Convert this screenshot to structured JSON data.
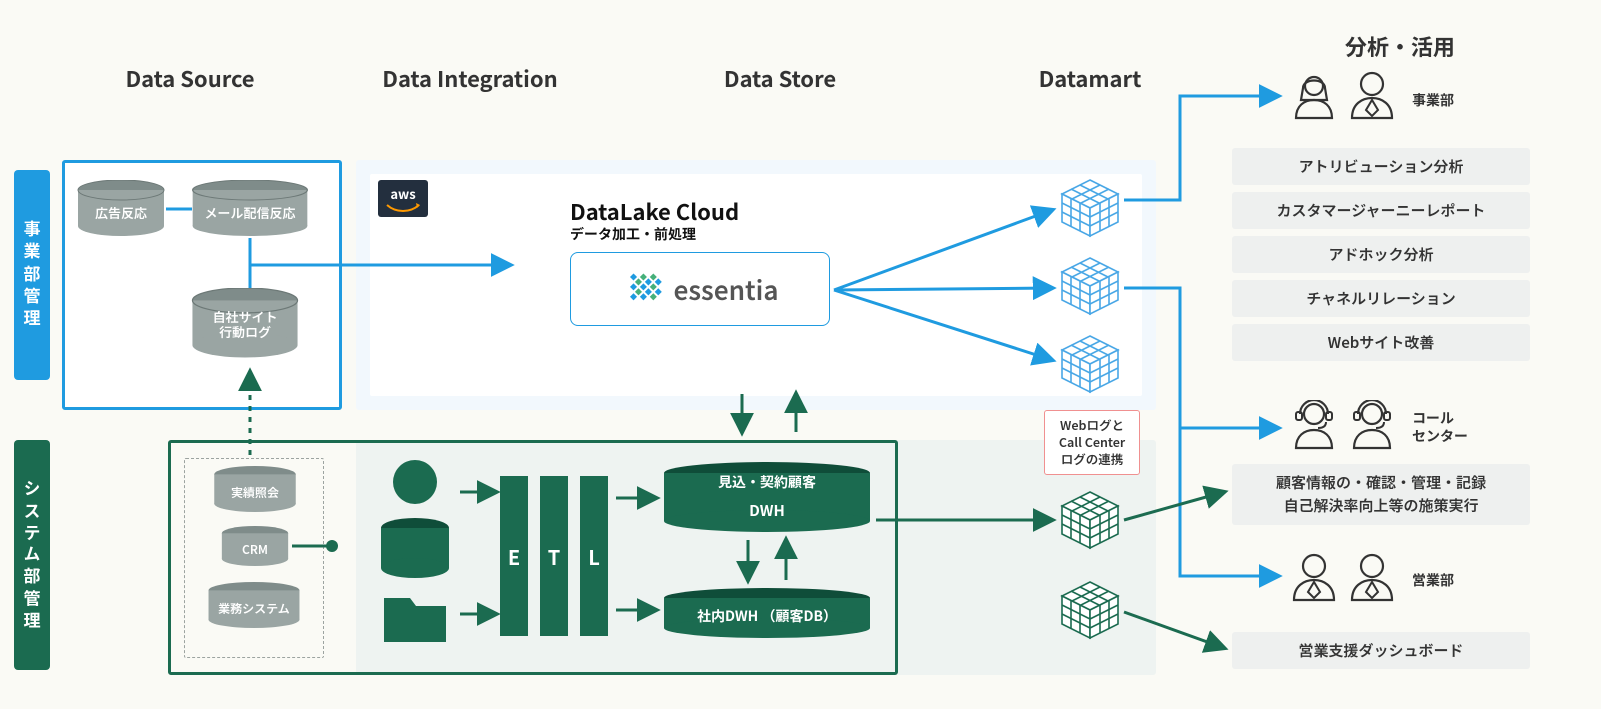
{
  "headers": {
    "source": "Data Source",
    "integration": "Data Integration",
    "store": "Data Store",
    "mart": "Datamart",
    "use": "分析・活用"
  },
  "side": {
    "biz": "事業部管理",
    "sys": "システム部管理"
  },
  "top_sources": {
    "ad": "広告反応",
    "mail": "メール配信反応",
    "site": "自社サイト\n行動ログ"
  },
  "aws": "aws",
  "datalake": {
    "title": "DataLake Cloud",
    "sub": "データ加工・前処理",
    "brand": "essentia"
  },
  "link_box": "Webログと\nCall Center\nログの連携",
  "bottom_sources": {
    "a": "実績照会",
    "b": "CRM",
    "c": "業務システム"
  },
  "etl": {
    "e": "E",
    "t": "T",
    "l": "L"
  },
  "dwh": {
    "top1": "見込・契約顧客",
    "top2": "DWH",
    "bottom": "社内DWH （顧客DB）"
  },
  "use": {
    "biz_label": "事業部",
    "biz_items": [
      "アトリビューション分析",
      "カスタマージャーニーレポート",
      "アドホック分析",
      "チャネルリレーション",
      "Webサイト改善"
    ],
    "cc_label": "コール\nセンター",
    "cc_item": "顧客情報の・確認・管理・記録\n自己解決率向上等の施策実行",
    "sales_label": "営業部",
    "sales_item": "営業支援ダッシュボード"
  }
}
